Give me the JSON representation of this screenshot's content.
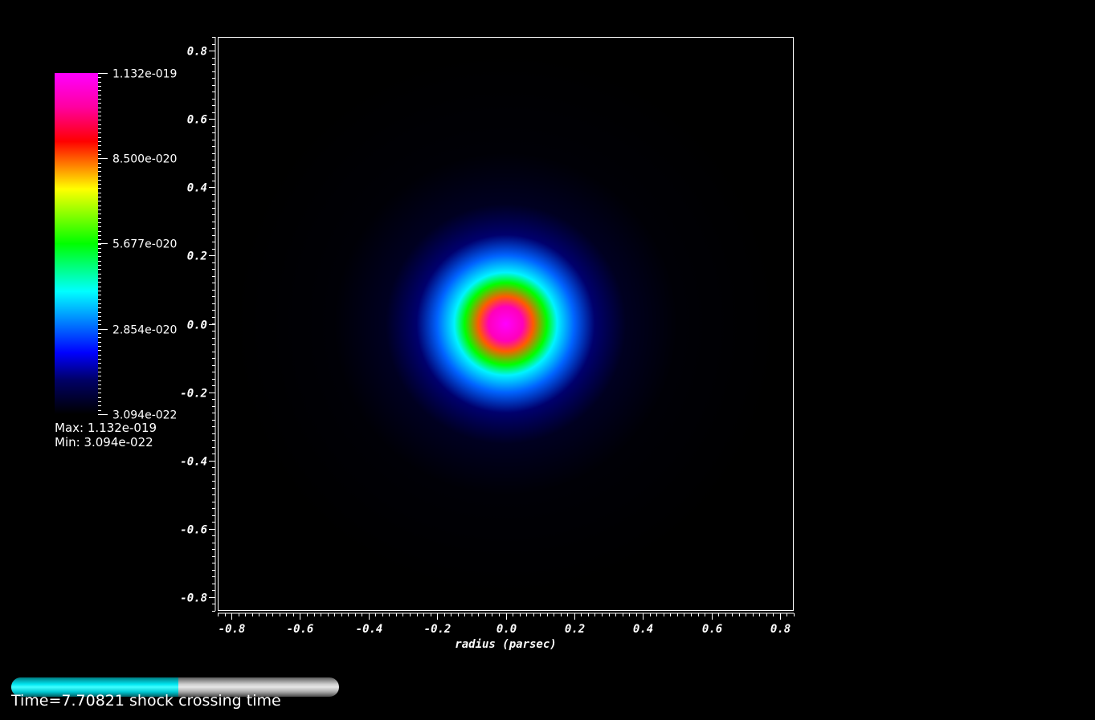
{
  "chart_data": {
    "type": "heatmap",
    "title": "",
    "xlabel": "radius (parsec)",
    "ylabel": "",
    "xlim": [
      -0.84,
      0.84
    ],
    "ylim": [
      -0.84,
      0.84
    ],
    "x_ticks": [
      -0.8,
      -0.6,
      -0.4,
      -0.2,
      0.0,
      0.2,
      0.4,
      0.6,
      0.8
    ],
    "y_ticks": [
      -0.8,
      -0.6,
      -0.4,
      -0.2,
      0.0,
      0.2,
      0.4,
      0.6,
      0.8
    ],
    "x_tick_labels": [
      "-0.8",
      "-0.6",
      "-0.4",
      "-0.2",
      "0.0",
      "0.2",
      "0.4",
      "0.6",
      "0.8"
    ],
    "y_tick_labels": [
      "-0.8",
      "-0.6",
      "-0.4",
      "-0.2",
      "0.0",
      "0.2",
      "0.4",
      "0.6",
      "0.8"
    ],
    "grid": false,
    "field": {
      "shape": "radially-symmetric blob centered at origin",
      "center": [
        0.0,
        0.0
      ],
      "radial_profile": [
        {
          "r": 0.0,
          "value": 1.132e-19
        },
        {
          "r": 0.05,
          "value": 1.05e-19
        },
        {
          "r": 0.08,
          "value": 8.5e-20
        },
        {
          "r": 0.12,
          "value": 5.677e-20
        },
        {
          "r": 0.15,
          "value": 4e-20
        },
        {
          "r": 0.2,
          "value": 2.854e-20
        },
        {
          "r": 0.26,
          "value": 1.2e-20
        },
        {
          "r": 0.35,
          "value": 4e-21
        },
        {
          "r": 0.5,
          "value": 1e-21
        },
        {
          "r": 0.8,
          "value": 3.094e-22
        }
      ]
    },
    "colorbar": {
      "placement": "left",
      "min": 3.094e-22,
      "max": 1.132e-19,
      "tick_values": [
        1.132e-19,
        8.5e-20,
        5.677e-20,
        2.854e-20,
        3.094e-22
      ],
      "tick_labels": [
        "1.132e-019",
        "8.500e-020",
        "5.677e-020",
        "2.854e-020",
        "3.094e-022"
      ],
      "colormap": [
        {
          "pos": 0.0,
          "color": "#000000"
        },
        {
          "pos": 0.1,
          "color": "#000066"
        },
        {
          "pos": 0.18,
          "color": "#0000ff"
        },
        {
          "pos": 0.36,
          "color": "#00ffff"
        },
        {
          "pos": 0.5,
          "color": "#00ff00"
        },
        {
          "pos": 0.66,
          "color": "#ffff00"
        },
        {
          "pos": 0.8,
          "color": "#ff0000"
        },
        {
          "pos": 0.9,
          "color": "#ff00a0"
        },
        {
          "pos": 1.0,
          "color": "#ff00ff"
        }
      ],
      "max_label": "Max:  1.132e-019",
      "min_label": "Min:  3.094e-022"
    }
  },
  "time_slider": {
    "progress": 0.51,
    "label": "Time=7.70821 shock crossing time"
  }
}
